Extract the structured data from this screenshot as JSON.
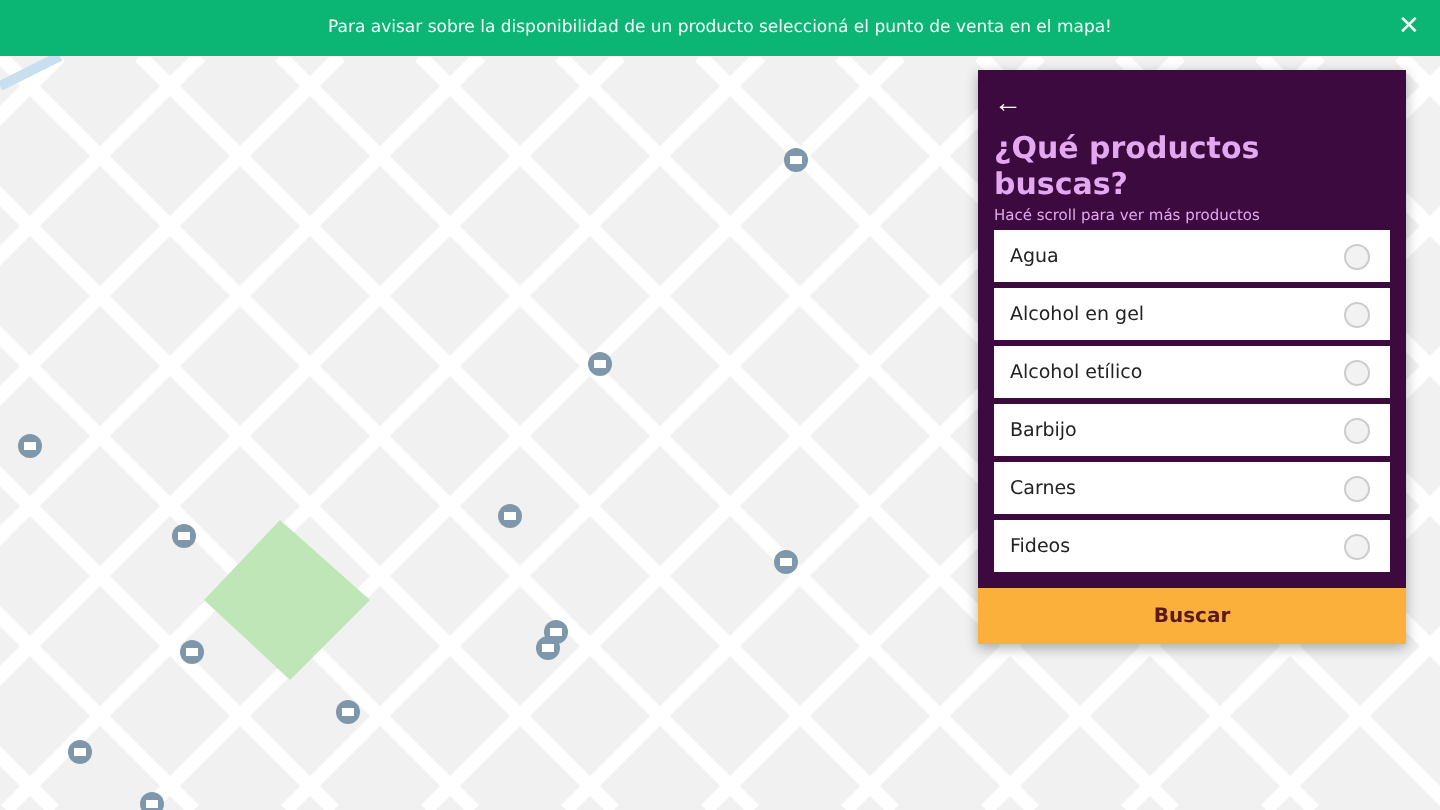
{
  "banner": {
    "text": "Para avisar sobre la disponibilidad de un producto seleccioná el punto de venta en el mapa!",
    "close": "✕"
  },
  "panel": {
    "back": "←",
    "title": "¿Qué productos buscas?",
    "hint": "Hacé scroll para ver más productos",
    "products": [
      {
        "label": "Agua",
        "selected": false
      },
      {
        "label": "Alcohol en gel",
        "selected": false
      },
      {
        "label": "Alcohol etílico",
        "selected": false
      },
      {
        "label": "Barbijo",
        "selected": false
      },
      {
        "label": "Carnes",
        "selected": false
      },
      {
        "label": "Fideos",
        "selected": false
      }
    ],
    "button": "Buscar"
  }
}
